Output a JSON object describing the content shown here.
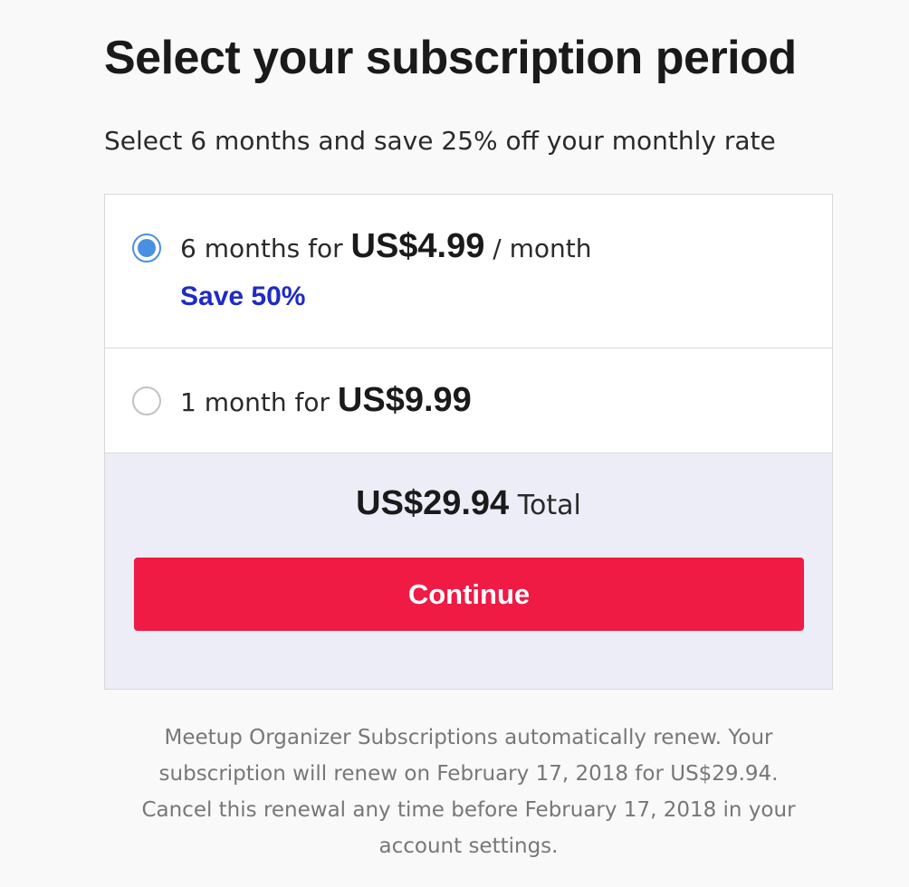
{
  "header": {
    "title": "Select your subscription period",
    "subtitle": "Select 6 months and save 25% off your monthly rate"
  },
  "options": [
    {
      "prefix": "6 months for",
      "price": "US$4.99",
      "suffix": "/ month",
      "badge": "Save 50%",
      "selected": true
    },
    {
      "prefix": "1 month for",
      "price": "US$9.99",
      "selected": false
    }
  ],
  "summary": {
    "amount": "US$29.94",
    "label": "Total",
    "continue_label": "Continue"
  },
  "footnote": {
    "lines": [
      "Meetup Organizer Subscriptions automatically renew. Your",
      "subscription will renew on February 17, 2018 for US$29.94.",
      "Cancel this renewal any time before February 17, 2018 in your",
      "account settings."
    ]
  },
  "colors": {
    "accent_blue": "#4a90e2",
    "save_text": "#1f2bc4",
    "continue_button": "#ef1b44",
    "summary_background": "#ededf8"
  }
}
